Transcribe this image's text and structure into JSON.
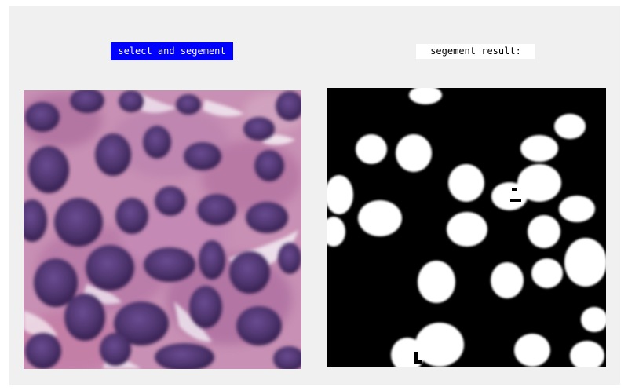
{
  "controls": {
    "select_button_label": "select and segement",
    "result_label": "segement result:"
  },
  "images": {
    "source_alt": "stained tissue microscopy image",
    "result_alt": "binary segmentation mask"
  },
  "colors": {
    "button_bg": "#0000ff",
    "button_text": "#ffffff",
    "window_bg": "#f0f0f0",
    "tissue_background": "#c890b4",
    "nucleus": "#4a2f70",
    "mask_background": "#000000",
    "mask_foreground": "#ffffff"
  }
}
